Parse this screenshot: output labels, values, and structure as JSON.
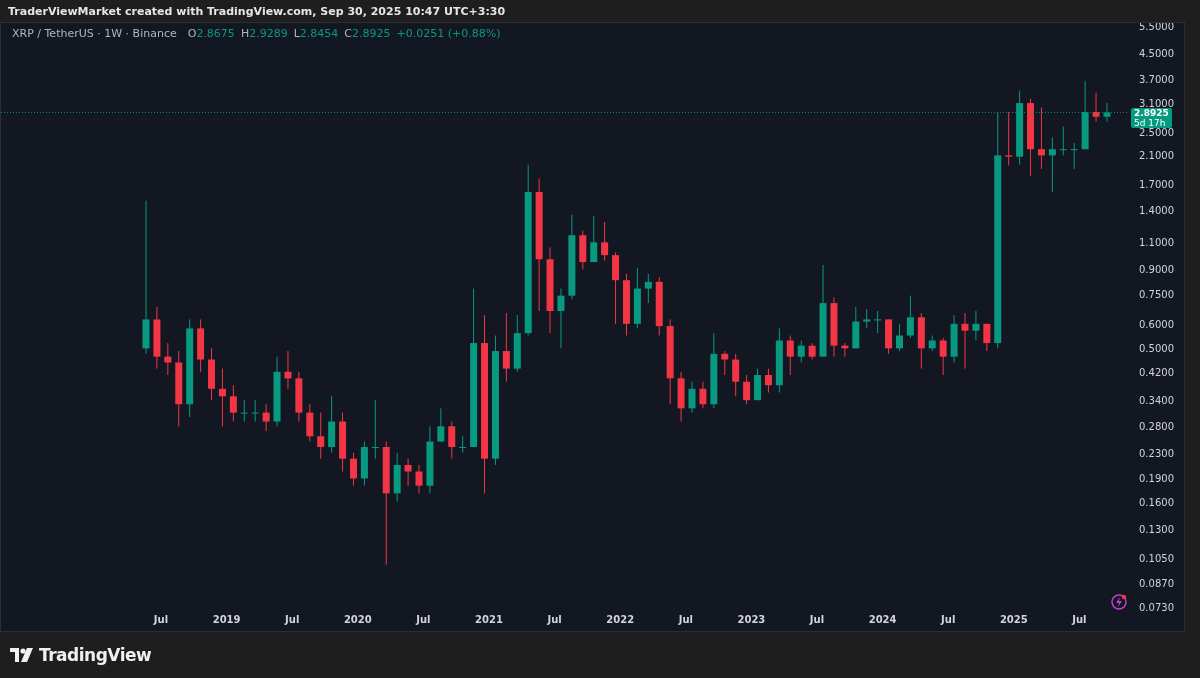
{
  "header": {
    "title": "TraderViewMarket created with TradingView.com, Sep 30, 2025 10:47 UTC+3:30"
  },
  "legend": {
    "symbol": "XRP / TetherUS · 1W · Binance",
    "ohlc": [
      {
        "label": "O",
        "value": "2.8675"
      },
      {
        "label": "H",
        "value": "2.9289"
      },
      {
        "label": "L",
        "value": "2.8454"
      },
      {
        "label": "C",
        "value": "2.8925"
      }
    ],
    "change": "+0.0251 (+0.88%)"
  },
  "price_tag": {
    "price": "2.8925",
    "countdown": "5d 17h"
  },
  "price_axis": {
    "labels": [
      "5.5000",
      "4.5000",
      "3.7000",
      "3.1000",
      "2.5000",
      "2.1000",
      "1.7000",
      "1.4000",
      "1.1000",
      "0.9000",
      "0.7500",
      "0.6000",
      "0.5000",
      "0.4200",
      "0.3400",
      "0.2800",
      "0.2300",
      "0.1900",
      "0.1600",
      "0.1300",
      "0.1050",
      "0.0870",
      "0.0730"
    ]
  },
  "time_axis": {
    "labels": [
      "Jul",
      "2019",
      "Jul",
      "2020",
      "Jul",
      "2021",
      "Jul",
      "2022",
      "Jul",
      "2023",
      "Jul",
      "2024",
      "Jul",
      "2025",
      "Jul"
    ]
  },
  "footer": {
    "brand": "TradingView"
  }
}
